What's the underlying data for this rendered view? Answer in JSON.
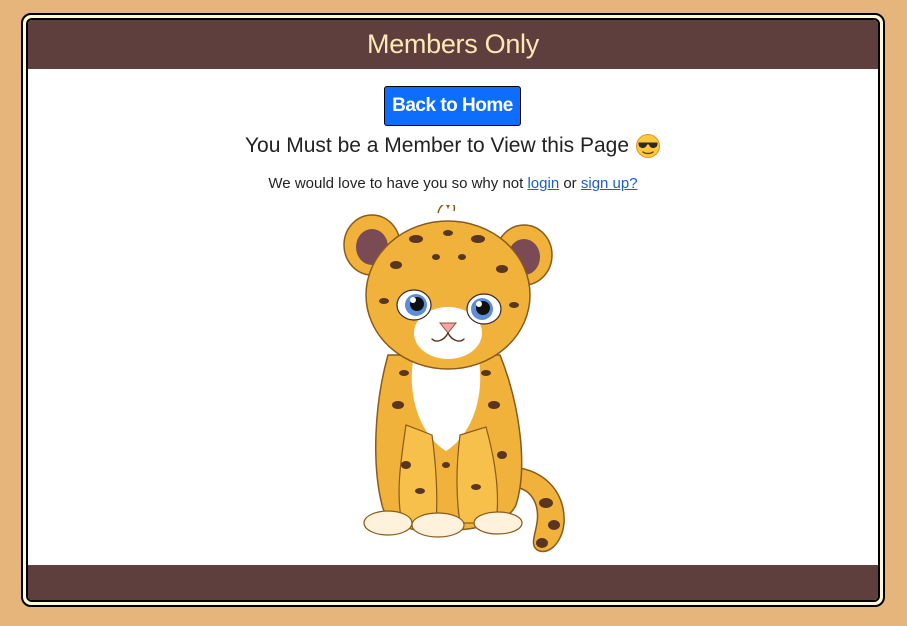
{
  "header": {
    "title": "Members Only"
  },
  "actions": {
    "home_button_label": "Back to Home"
  },
  "notice": {
    "title": "You Must be a Member to View this Page",
    "emoji_icon": "sunglasses-face-icon",
    "text_before": "We would love to have you so why not ",
    "login_link": "login",
    "text_middle": " or ",
    "signup_link": "sign up?"
  },
  "illustration": {
    "icon": "leopard-cub-icon"
  },
  "colors": {
    "page_background": "#e5b57b",
    "header_footer": "#5f3e3e",
    "title_text": "#fde9b6",
    "button": "#0d6efd",
    "link": "#1a5fc7"
  }
}
